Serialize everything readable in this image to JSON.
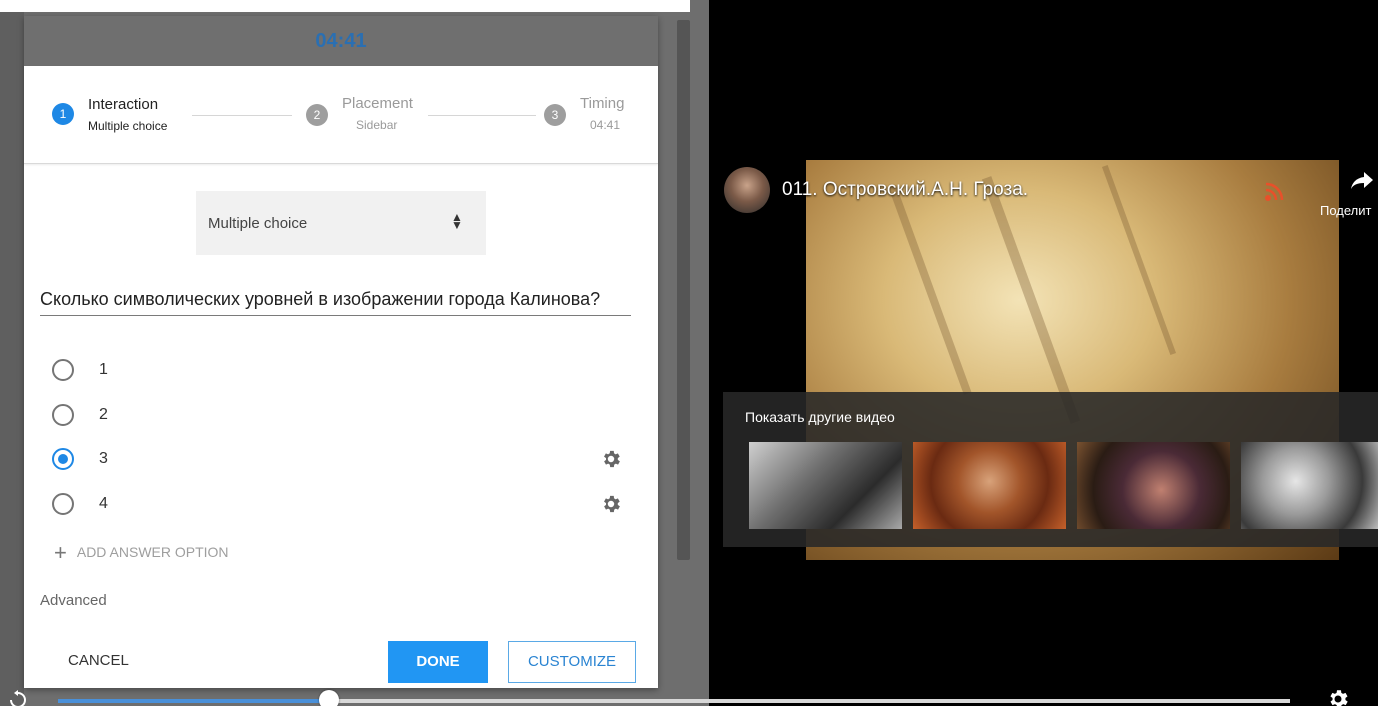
{
  "dialog": {
    "timer": "04:41",
    "steps": [
      {
        "number": "1",
        "title": "Interaction",
        "subtitle": "Multiple choice",
        "active": true
      },
      {
        "number": "2",
        "title": "Placement",
        "subtitle": "Sidebar",
        "active": false
      },
      {
        "number": "3",
        "title": "Timing",
        "subtitle": "04:41",
        "active": false
      }
    ],
    "type_select": {
      "value": "Multiple choice"
    },
    "question": "Сколько символических уровней в изображении города Калинова?",
    "options": [
      {
        "label": "1",
        "selected": false,
        "has_settings": false
      },
      {
        "label": "2",
        "selected": false,
        "has_settings": false
      },
      {
        "label": "3",
        "selected": true,
        "has_settings": true
      },
      {
        "label": "4",
        "selected": false,
        "has_settings": true
      }
    ],
    "add_option_label": "ADD ANSWER OPTION",
    "advanced_label": "Advanced",
    "cancel_label": "CANCEL",
    "done_label": "DONE",
    "customize_label": "CUSTOMIZE"
  },
  "video": {
    "title": "011. Островский.А.Н. Гроза.",
    "share_label": "Поделит",
    "more_videos_label": "Показать другие видео",
    "thumbnail_count": 4
  },
  "player": {
    "progress_fraction": 0.22
  },
  "colors": {
    "accent": "#2196f3",
    "timer": "#2a6fb2",
    "step_active": "#1e88e5",
    "step_inactive": "#9e9e9e"
  },
  "icons": [
    "settings-gear-icon",
    "plus-icon",
    "rss-icon",
    "share-arrow-icon",
    "replay-icon",
    "player-settings-icon"
  ]
}
